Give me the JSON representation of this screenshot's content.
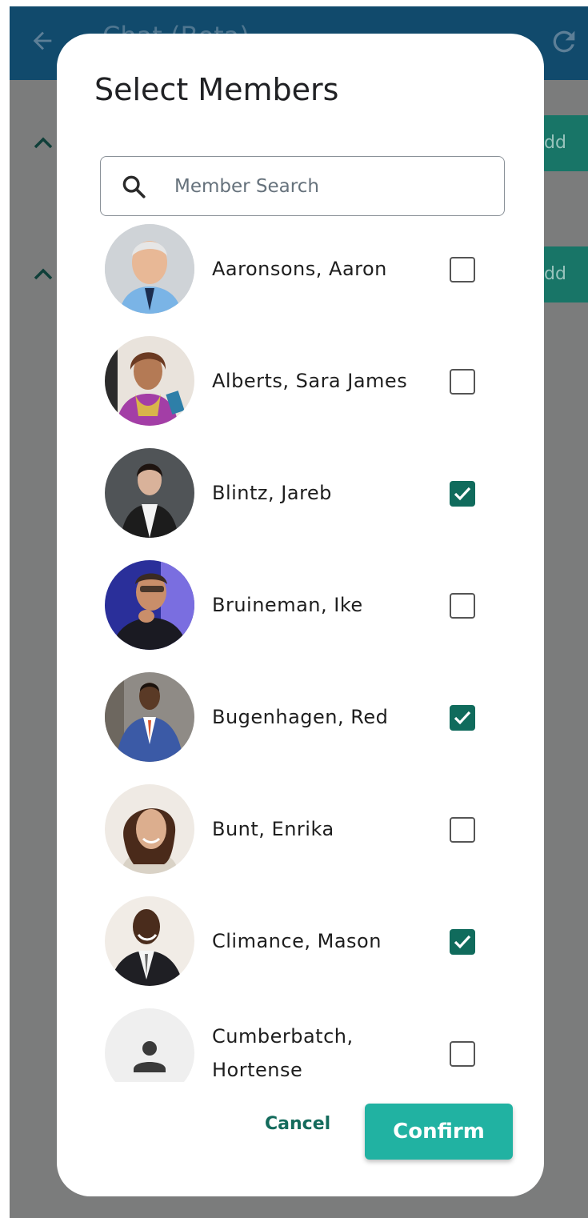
{
  "app_bar": {
    "title": "Chat (Beta)",
    "icons": {
      "back": "arrow-left-icon",
      "refresh": "refresh-icon"
    }
  },
  "background": {
    "sections": [
      {
        "chevron": "chevron-up-icon",
        "button_label": "dd"
      },
      {
        "chevron": "chevron-up-icon",
        "button_label": "dd"
      }
    ]
  },
  "dialog": {
    "title": "Select Members",
    "search": {
      "placeholder": "Member Search",
      "value": "",
      "icon": "search-icon"
    },
    "members": [
      {
        "name": "Aaronsons, Aaron",
        "checked": false,
        "avatar": "photo"
      },
      {
        "name": "Alberts, Sara James",
        "checked": false,
        "avatar": "photo"
      },
      {
        "name": "Blintz, Jareb",
        "checked": true,
        "avatar": "photo"
      },
      {
        "name": "Bruineman, Ike",
        "checked": false,
        "avatar": "photo"
      },
      {
        "name": "Bugenhagen, Red",
        "checked": true,
        "avatar": "photo"
      },
      {
        "name": "Bunt, Enrika",
        "checked": false,
        "avatar": "photo"
      },
      {
        "name": "Climance, Mason",
        "checked": true,
        "avatar": "photo"
      },
      {
        "name": "Cumberbatch, Hortense",
        "checked": false,
        "avatar": "person-placeholder-icon"
      }
    ],
    "cancel_label": "Cancel",
    "confirm_label": "Confirm"
  },
  "colors": {
    "app_bar": "#114a6c",
    "scrim": "#7b7c7c",
    "accent": "#21b2a2",
    "checkbox_checked": "#106b5c",
    "add_button": "#187567"
  }
}
